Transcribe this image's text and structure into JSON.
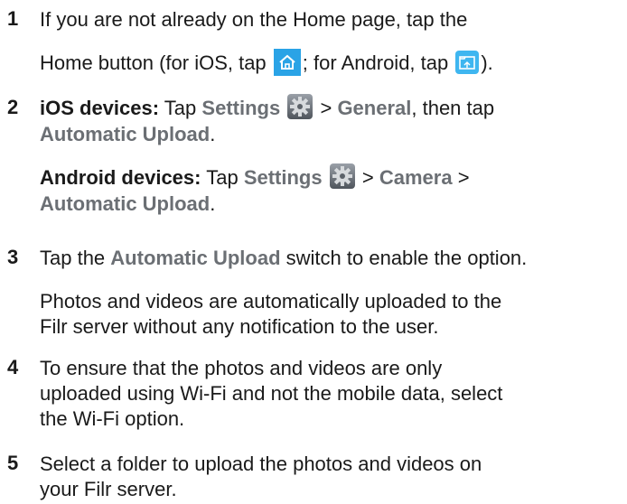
{
  "steps": [
    {
      "num": "1",
      "line1": "If you are not already on the Home page, tap the",
      "line2_a": "Home button (for iOS, tap",
      "line2_b": "; for Android, tap",
      "line2_c": ")."
    },
    {
      "num": "2",
      "ios_label": "iOS devices:",
      "tap": "Tap",
      "settings": "Settings",
      "gt": ">",
      "general": "General",
      "then_tap": ", then tap",
      "automatic_upload": "Automatic Upload",
      "period": ".",
      "android_label": "Android devices:",
      "camera": "Camera"
    },
    {
      "num": "3",
      "tap_the": "Tap the",
      "automatic_upload": "Automatic Upload",
      "rest": "switch to enable the option.",
      "note_line1": "Photos and videos are automatically uploaded to the",
      "note_line2": "Filr server without any notification to the user."
    },
    {
      "num": "4",
      "line1": "To ensure that the photos and videos are only",
      "line2": "uploaded using Wi-Fi and not the mobile data, select",
      "line3": "the Wi-Fi option."
    },
    {
      "num": "5",
      "line1": "Select a folder to upload the photos and videos on",
      "line2": "your Filr server."
    }
  ],
  "icons": {
    "home_ios": "home-icon",
    "home_android": "home-folder-icon",
    "settings": "gear-icon",
    "accent_ios": "#2aa3e6",
    "accent_android": "#3fb6f0",
    "ui_text": "#6b6f74"
  }
}
